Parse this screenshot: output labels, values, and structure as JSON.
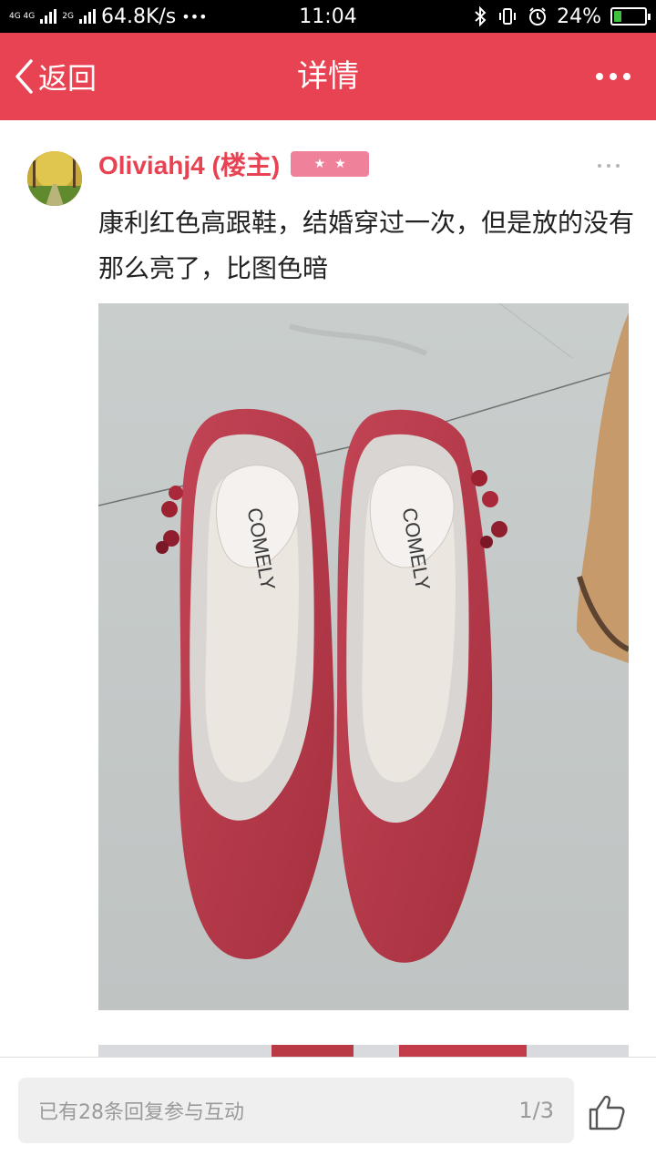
{
  "status_bar": {
    "network_top": "4G 4G",
    "network_2g": "2G",
    "speed": "64.8K/s",
    "dots": "•••",
    "time": "11:04",
    "battery_percent": "24%",
    "battery_level": 0.24,
    "icons": [
      "bluetooth-icon",
      "vibrate-icon",
      "alarm-icon",
      "battery-icon"
    ]
  },
  "nav": {
    "back_label": "返回",
    "title": "详情",
    "accent_color": "#e84353"
  },
  "post": {
    "author": "Oliviahj4 (楼主)",
    "stars": "★★",
    "text": "康利红色高跟鞋，结婚穿过一次，但是放的没有那么亮了，比图色暗",
    "insole_brand": "COMELY"
  },
  "bottom": {
    "reply_placeholder": "已有28条回复参与互动",
    "page_indicator": "1/3"
  }
}
